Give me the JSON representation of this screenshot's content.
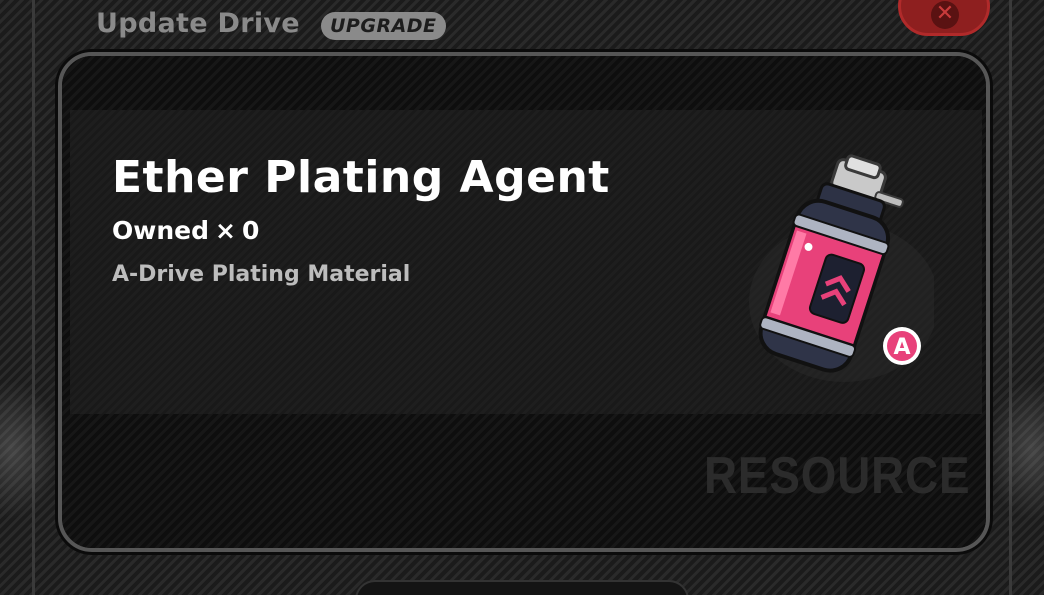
{
  "header": {
    "title": "Update Drive",
    "badge": "UPGRADE"
  },
  "close_button": {
    "icon": "close-icon",
    "glyph": "✕",
    "color": "#8e1f1f"
  },
  "item": {
    "name": "Ether Plating Agent",
    "owned_label": "Owned",
    "owned_symbol": "×",
    "owned_count": "0",
    "subtitle": "A-Drive Plating Material",
    "icon": "plating-agent-canister-icon",
    "rank_badge": "A",
    "accent_color": "#e8417a"
  },
  "watermark": "RESOURCE"
}
